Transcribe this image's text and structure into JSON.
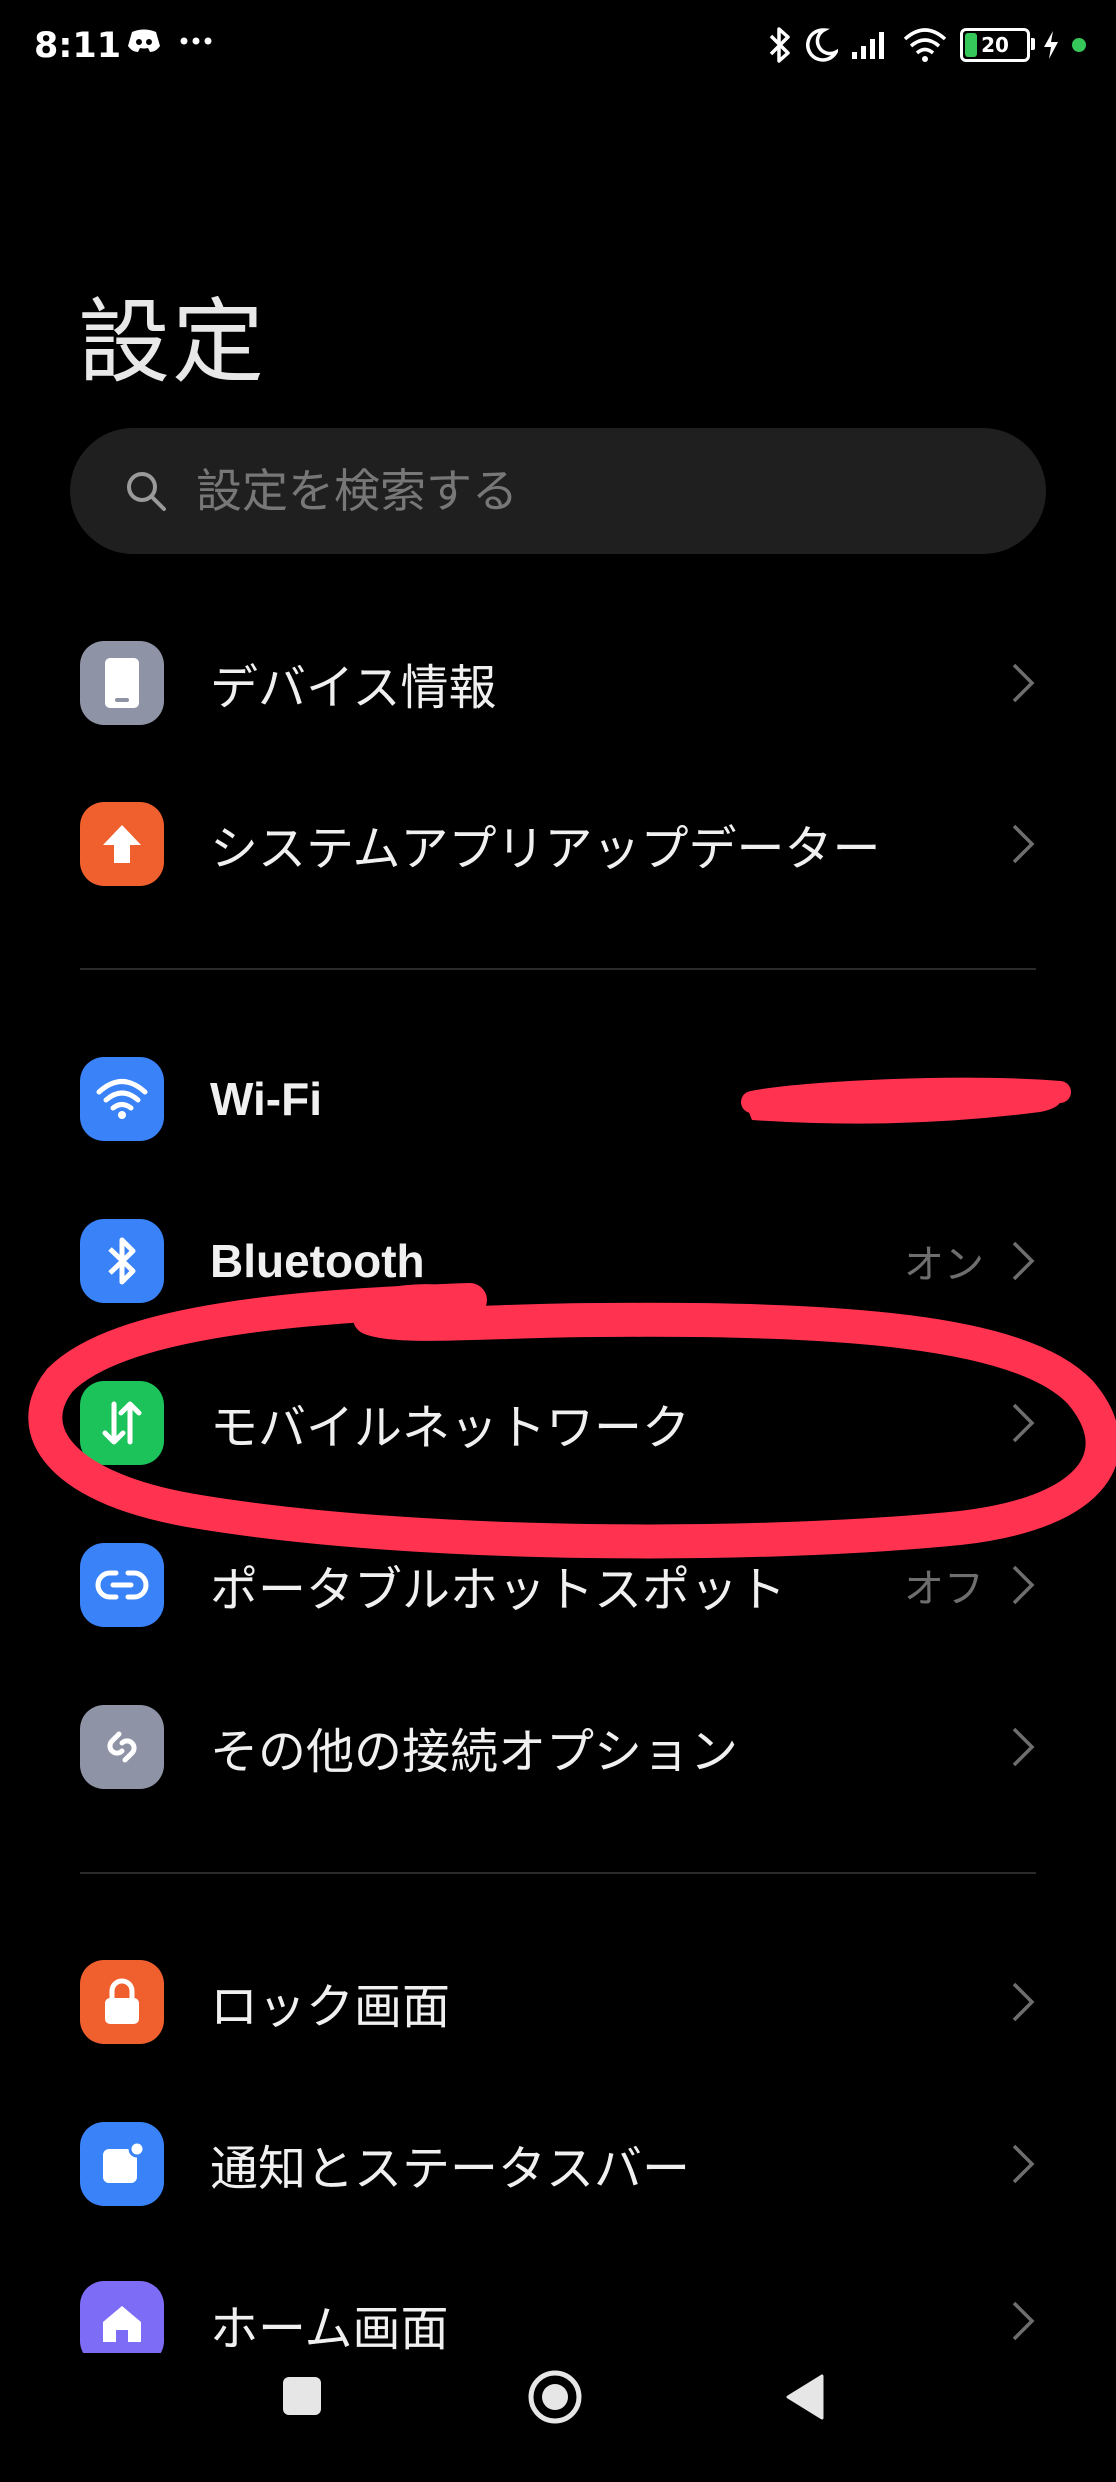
{
  "status_bar": {
    "time": "8:11",
    "battery": "20",
    "icons": [
      "discord-icon",
      "more-dots-icon",
      "bluetooth-icon",
      "moon-icon",
      "signal-icon",
      "wifi-icon",
      "battery-icon",
      "charging-icon"
    ],
    "battery_color": "#35c759"
  },
  "page": {
    "title": "設定"
  },
  "search": {
    "placeholder": "設定を検索する"
  },
  "groups": [
    {
      "items": [
        {
          "label": "デバイス情報",
          "value": "",
          "icon": "phone-icon",
          "color": "#8e93a6"
        },
        {
          "label": "システムアプリアップデーター",
          "value": "",
          "icon": "upload-arrow-icon",
          "color": "#f0602f"
        }
      ]
    },
    {
      "items": [
        {
          "label": "Wi-Fi",
          "value": "",
          "icon": "wifi-icon",
          "color": "#3a82f7"
        },
        {
          "label": "Bluetooth",
          "value": "オン",
          "icon": "bluetooth-icon",
          "color": "#3a82f7"
        },
        {
          "label": "モバイルネットワーク",
          "value": "",
          "icon": "data-arrows-icon",
          "color": "#1cc35a"
        },
        {
          "label": "ポータブルホットスポット",
          "value": "オフ",
          "icon": "hotspot-icon",
          "color": "#3a82f7"
        },
        {
          "label": "その他の接続オプション",
          "value": "",
          "icon": "link-icon",
          "color": "#8e93a6"
        }
      ]
    },
    {
      "items": [
        {
          "label": "ロック画面",
          "value": "",
          "icon": "lock-icon",
          "color": "#f0602f"
        },
        {
          "label": "通知とステータスバー",
          "value": "",
          "icon": "notification-icon",
          "color": "#3a82f7"
        },
        {
          "label": "ホーム画面",
          "value": "",
          "icon": "home-icon",
          "color": "#7d6cf5"
        }
      ]
    }
  ],
  "nav_bar": {
    "icons": [
      "recents-square-icon",
      "home-circle-icon",
      "back-triangle-icon"
    ]
  },
  "annotation": {
    "color": "#ff3350"
  }
}
